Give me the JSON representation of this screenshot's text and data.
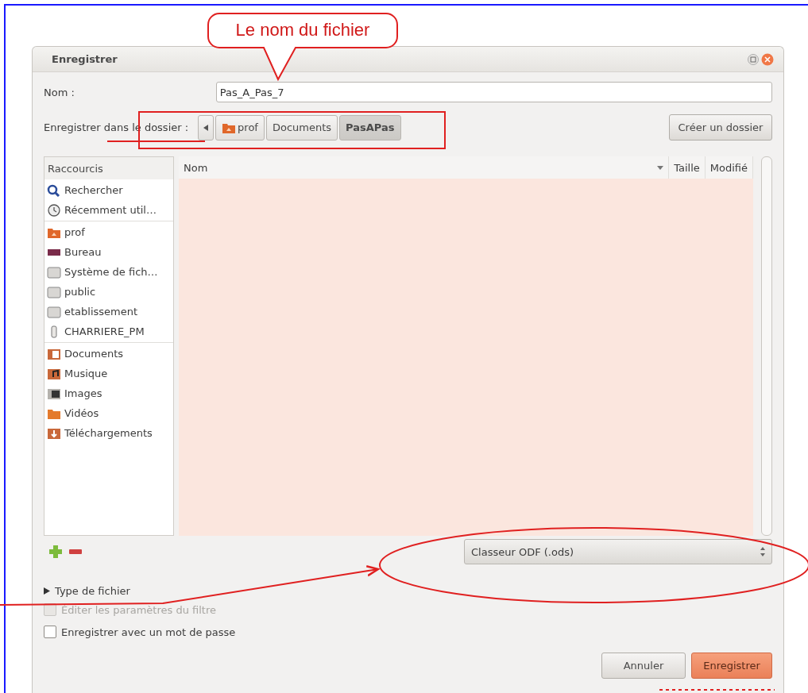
{
  "annotation": {
    "callout": "Le nom du fichier"
  },
  "dialog": {
    "title": "Enregistrer",
    "name_label": "Nom :",
    "name_value": "Pas_A_Pas_7",
    "folder_label": "Enregistrer dans le dossier :",
    "path": [
      {
        "label": "prof",
        "kind": "home",
        "selected": false
      },
      {
        "label": "Documents",
        "kind": "plain",
        "selected": false
      },
      {
        "label": "PasAPas",
        "kind": "plain",
        "selected": true
      }
    ],
    "create_folder": "Créer un dossier",
    "sidebar": {
      "header": "Raccourcis",
      "groups": [
        [
          {
            "label": "Rechercher",
            "kind": "search"
          },
          {
            "label": "Récemment util…",
            "kind": "recent"
          }
        ],
        [
          {
            "label": "prof",
            "kind": "home"
          },
          {
            "label": "Bureau",
            "kind": "desktop"
          },
          {
            "label": "Système de fich…",
            "kind": "drive"
          },
          {
            "label": "public",
            "kind": "drive"
          },
          {
            "label": "etablissement",
            "kind": "drive"
          },
          {
            "label": "CHARRIERE_PM",
            "kind": "usb"
          }
        ],
        [
          {
            "label": "Documents",
            "kind": "documents"
          },
          {
            "label": "Musique",
            "kind": "music"
          },
          {
            "label": "Images",
            "kind": "images"
          },
          {
            "label": "Vidéos",
            "kind": "videos"
          },
          {
            "label": "Téléchargements",
            "kind": "downloads"
          }
        ]
      ]
    },
    "columns": [
      "Nom",
      "Taille",
      "Modifié"
    ],
    "file_type": "Classeur ODF (.ods)",
    "expander": {
      "label": "Type de fichier",
      "expanded": false
    },
    "options": [
      {
        "label": "Éditer les paramètres du filtre",
        "checked": false,
        "disabled": true
      },
      {
        "label": "Enregistrer avec un mot de passe",
        "checked": false,
        "disabled": false
      }
    ],
    "buttons": [
      {
        "label": "Annuler",
        "kind": "normal"
      },
      {
        "label": "Enregistrer",
        "kind": "default"
      }
    ]
  }
}
